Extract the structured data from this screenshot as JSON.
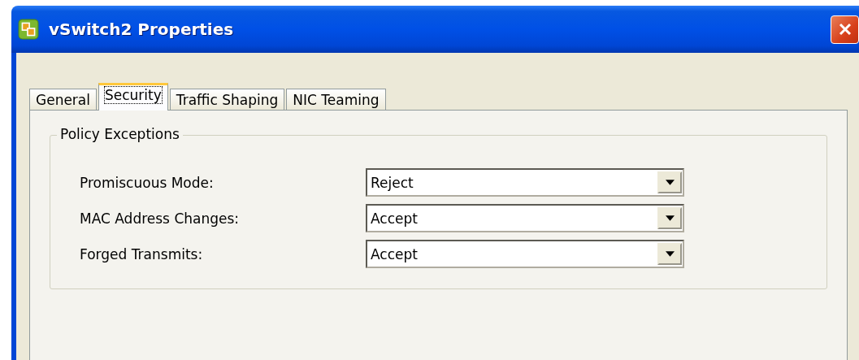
{
  "window": {
    "title": "vSwitch2 Properties"
  },
  "tabs": [
    {
      "label": "General",
      "selected": false
    },
    {
      "label": "Security",
      "selected": true
    },
    {
      "label": "Traffic Shaping",
      "selected": false
    },
    {
      "label": "NIC Teaming",
      "selected": false
    }
  ],
  "group": {
    "title": "Policy Exceptions",
    "fields": [
      {
        "label": "Promiscuous Mode:",
        "value": "Reject"
      },
      {
        "label": "MAC Address Changes:",
        "value": "Accept"
      },
      {
        "label": "Forged Transmits:",
        "value": "Accept"
      }
    ]
  }
}
